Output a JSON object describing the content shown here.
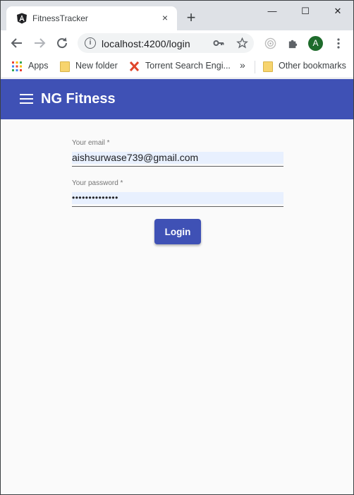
{
  "browser": {
    "tab_title": "FitnessTracker",
    "tab_close": "×",
    "new_tab": "+",
    "url": "localhost:4200/login",
    "profile_initial": "A",
    "window": {
      "minimize": "—",
      "maximize": "☐",
      "close": "✕"
    }
  },
  "bookmarks": {
    "items": [
      "Apps",
      "New folder",
      "Torrent Search Engi..."
    ],
    "overflow": "»",
    "other": "Other bookmarks"
  },
  "app": {
    "title": "NG Fitness",
    "accent": "#3f51b5"
  },
  "login": {
    "email_label": "Your email *",
    "email_value": "aishsurwase739@gmail.com",
    "password_label": "Your password *",
    "password_value": "••••••••••••••",
    "button_label": "Login"
  }
}
